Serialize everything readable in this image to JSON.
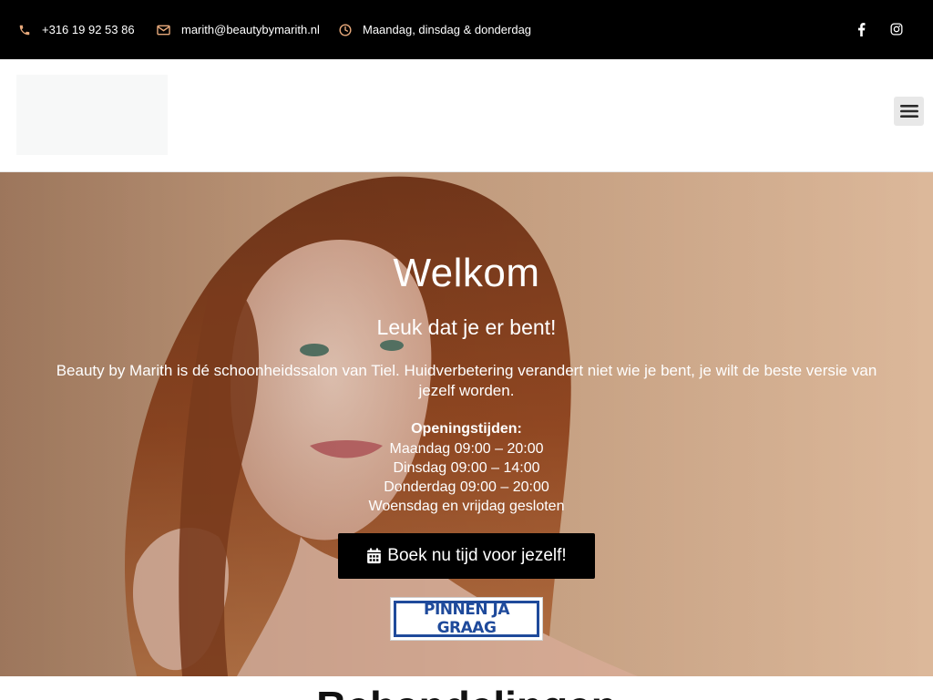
{
  "topbar": {
    "phone": "+316 19 92 53 86",
    "email": "marith@beautybymarith.nl",
    "days": "Maandag, dinsdag & donderdag",
    "icons": [
      "phone-icon",
      "envelope-icon",
      "clock-icon",
      "facebook-icon",
      "instagram-icon"
    ]
  },
  "hero": {
    "title": "Welkom",
    "subtitle": "Leuk dat je er bent!",
    "intro": "Beauty by Marith is dé schoonheidssalon van Tiel. Huidverbetering verandert niet wie je bent, je wilt de beste versie van jezelf worden.",
    "hours_title": "Openingstijden:",
    "hours": [
      "Maandag 09:00 – 20:00",
      "Dinsdag 09:00 – 14:00",
      "Donderdag 09:00 – 20:00",
      "Woensdag en vrijdag gesloten"
    ],
    "book_button": "Boek nu tijd voor jezelf!",
    "pin_badge": "PINNEN JA GRAAG"
  },
  "next_section": {
    "title": "Behandelingen"
  },
  "colors": {
    "topbar_bg": "#000000",
    "accent_icon": "#e7a97b",
    "button_bg": "#000000",
    "pin_blue": "#1f4a9b"
  }
}
